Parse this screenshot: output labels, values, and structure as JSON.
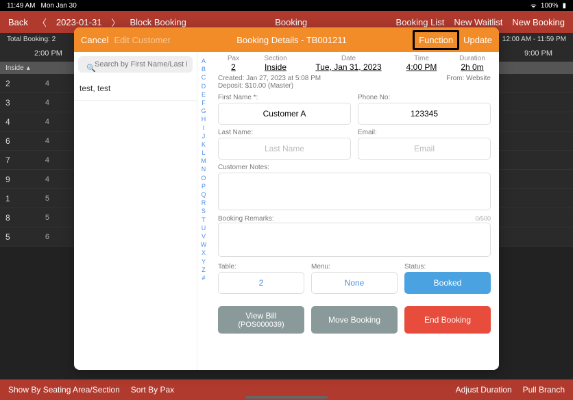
{
  "status": {
    "time": "11:49 AM",
    "date": "Mon Jan 30",
    "battery": "100%"
  },
  "nav": {
    "back": "Back",
    "date": "2023-01-31",
    "block": "Block Booking",
    "title": "Booking",
    "list": "Booking List",
    "waitlist": "New Waitlist",
    "newbooking": "New Booking"
  },
  "subbar": {
    "total_label": "Total Booking:",
    "total_value": "2",
    "range": "12:00 AM - 11:59 PM"
  },
  "timeline": {
    "t1": "2:00 PM",
    "t2": "9:00 PM",
    "section": "Inside"
  },
  "rows": [
    {
      "n": "2",
      "c": "4"
    },
    {
      "n": "3",
      "c": "4"
    },
    {
      "n": "4",
      "c": "4"
    },
    {
      "n": "6",
      "c": "4"
    },
    {
      "n": "7",
      "c": "4"
    },
    {
      "n": "9",
      "c": "4"
    },
    {
      "n": "1",
      "c": "5"
    },
    {
      "n": "8",
      "c": "5"
    },
    {
      "n": "5",
      "c": "6"
    }
  ],
  "bottom": {
    "seating": "Show By Seating Area/Section",
    "sort": "Sort By Pax",
    "adjust": "Adjust Duration",
    "pull": "Pull Branch"
  },
  "modal": {
    "cancel": "Cancel",
    "edit": "Edit Customer",
    "title": "Booking Details - TB001211",
    "function": "Function",
    "update": "Update",
    "search_ph": "Search by First Name/Last Name/Phone",
    "result": "test, test",
    "alpha": [
      "A",
      "B",
      "C",
      "D",
      "E",
      "F",
      "G",
      "H",
      "I",
      "J",
      "K",
      "L",
      "M",
      "N",
      "O",
      "P",
      "Q",
      "R",
      "S",
      "T",
      "U",
      "V",
      "W",
      "X",
      "Y",
      "Z",
      "#"
    ],
    "summary": {
      "pax_l": "Pax",
      "pax_v": "2",
      "sec_l": "Section",
      "sec_v": "Inside",
      "date_l": "Date",
      "date_v": "Tue, Jan 31, 2023",
      "time_l": "Time",
      "time_v": "4:00 PM",
      "dur_l": "Duration",
      "dur_v": "2h 0m"
    },
    "meta": {
      "created": "Created: Jan 27, 2023 at 5:08 PM",
      "from": "From: Website",
      "deposit": "Deposit: $10.00 (Master)"
    },
    "fn_l": "First Name *:",
    "fn_v": "Customer A",
    "ph_l": "Phone No:",
    "ph_v": "123345",
    "ln_l": "Last Name:",
    "ln_ph": "Last Name",
    "em_l": "Email:",
    "em_ph": "Email",
    "notes_l": "Customer Notes:",
    "remarks_l": "Booking Remarks:",
    "remarks_count": "0/500",
    "table_l": "Table:",
    "table_v": "2",
    "menu_l": "Menu:",
    "menu_v": "None",
    "status_l": "Status:",
    "status_v": "Booked",
    "view_bill": "View Bill",
    "view_bill_sub": "(POS000039)",
    "move": "Move Booking",
    "end": "End Booking"
  }
}
